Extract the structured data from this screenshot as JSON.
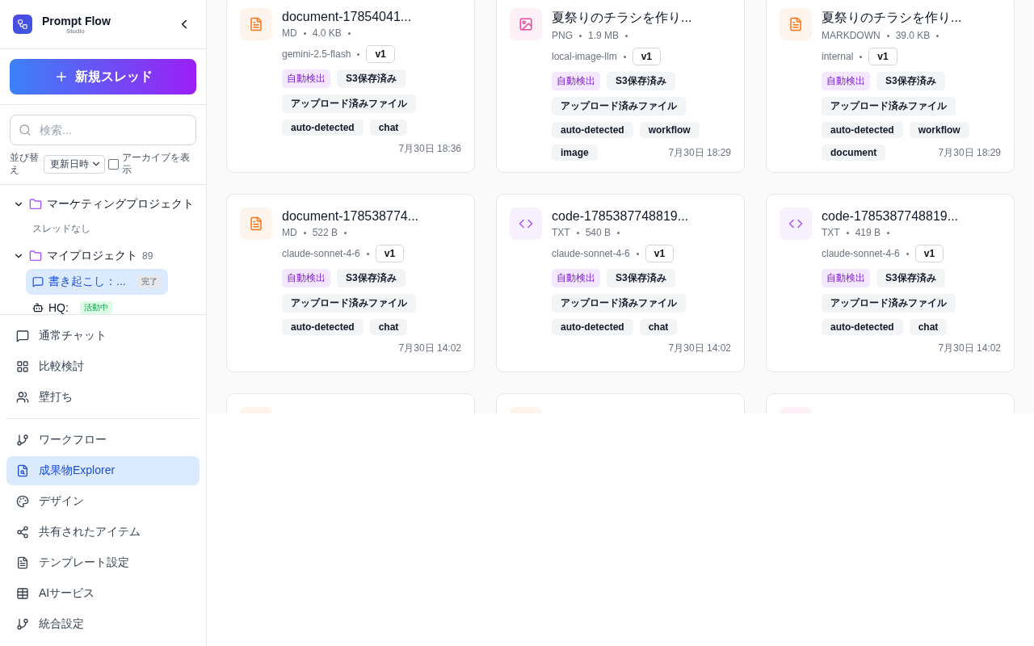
{
  "app": {
    "name": "Prompt Flow",
    "subtitle": "Studio"
  },
  "new_thread_button": "新規スレッド",
  "search": {
    "placeholder": "検索..."
  },
  "sort": {
    "label": "並び替え",
    "value": "更新日時",
    "archive_label": "アーカイブを表示",
    "archive_checked": false
  },
  "tree": [
    {
      "name": "マーケティングプロジェクト",
      "expanded": true,
      "empty_text": "スレッドなし"
    },
    {
      "name": "マイプロジェクト",
      "count": "89",
      "expanded": true,
      "children": [
        {
          "kind": "chat",
          "title": "書き起こし：...",
          "status": "完了",
          "selected": true
        },
        {
          "kind": "workflow",
          "title": "HQ:",
          "status": "活動中",
          "selected": false
        }
      ]
    }
  ],
  "nav_groups": [
    [
      {
        "label": "通常チャット",
        "selected": false
      },
      {
        "label": "比較検討",
        "selected": false
      },
      {
        "label": "壁打ち",
        "selected": false
      }
    ],
    [
      {
        "label": "ワークフロー",
        "selected": false
      },
      {
        "label": "成果物Explorer",
        "selected": true
      },
      {
        "label": "デザイン",
        "selected": false
      },
      {
        "label": "共有されたアイテム",
        "selected": false
      },
      {
        "label": "テンプレート設定",
        "selected": false
      },
      {
        "label": "AIサービス",
        "selected": false
      },
      {
        "label": "統合設定",
        "selected": false
      }
    ]
  ],
  "cards": [
    {
      "kind": "document",
      "title": "document-17854041...",
      "type": "MD",
      "size": "4.0 KB",
      "model": "gemini-2.5-flash",
      "version": "v1",
      "tags": [
        {
          "label": "自動検出",
          "kind": "auto"
        },
        {
          "label": "S3保存済み",
          "kind": "plain"
        },
        {
          "label": "アップロード済みファイル",
          "kind": "plain"
        },
        {
          "label": "auto-detected",
          "kind": "plain"
        },
        {
          "label": "chat",
          "kind": "plain"
        }
      ],
      "date": "7月30日 18:36"
    },
    {
      "kind": "image",
      "title": "夏祭りのチラシを作り...",
      "type": "PNG",
      "size": "1.9 MB",
      "model": "local-image-llm",
      "version": "v1",
      "tags": [
        {
          "label": "自動検出",
          "kind": "auto"
        },
        {
          "label": "S3保存済み",
          "kind": "plain"
        },
        {
          "label": "アップロード済みファイル",
          "kind": "plain"
        },
        {
          "label": "auto-detected",
          "kind": "plain"
        },
        {
          "label": "workflow",
          "kind": "plain"
        },
        {
          "label": "image",
          "kind": "plain"
        }
      ],
      "date": "7月30日 18:29"
    },
    {
      "kind": "document",
      "title": "夏祭りのチラシを作り...",
      "type": "MARKDOWN",
      "size": "39.0 KB",
      "model": "internal",
      "version": "v1",
      "tags": [
        {
          "label": "自動検出",
          "kind": "auto"
        },
        {
          "label": "S3保存済み",
          "kind": "plain"
        },
        {
          "label": "アップロード済みファイル",
          "kind": "plain"
        },
        {
          "label": "auto-detected",
          "kind": "plain"
        },
        {
          "label": "workflow",
          "kind": "plain"
        },
        {
          "label": "document",
          "kind": "plain"
        }
      ],
      "date": "7月30日 18:29"
    },
    {
      "kind": "document",
      "title": "document-178538774...",
      "type": "MD",
      "size": "522 B",
      "model": "claude-sonnet-4-6",
      "version": "v1",
      "tags": [
        {
          "label": "自動検出",
          "kind": "auto"
        },
        {
          "label": "S3保存済み",
          "kind": "plain"
        },
        {
          "label": "アップロード済みファイル",
          "kind": "plain"
        },
        {
          "label": "auto-detected",
          "kind": "plain"
        },
        {
          "label": "chat",
          "kind": "plain"
        }
      ],
      "date": "7月30日 14:02"
    },
    {
      "kind": "code",
      "title": "code-1785387748819...",
      "type": "TXT",
      "size": "540 B",
      "model": "claude-sonnet-4-6",
      "version": "v1",
      "tags": [
        {
          "label": "自動検出",
          "kind": "auto"
        },
        {
          "label": "S3保存済み",
          "kind": "plain"
        },
        {
          "label": "アップロード済みファイル",
          "kind": "plain"
        },
        {
          "label": "auto-detected",
          "kind": "plain"
        },
        {
          "label": "chat",
          "kind": "plain"
        }
      ],
      "date": "7月30日 14:02"
    },
    {
      "kind": "code",
      "title": "code-1785387748819...",
      "type": "TXT",
      "size": "419 B",
      "model": "claude-sonnet-4-6",
      "version": "v1",
      "tags": [
        {
          "label": "自動検出",
          "kind": "auto"
        },
        {
          "label": "S3保存済み",
          "kind": "plain"
        },
        {
          "label": "アップロード済みファイル",
          "kind": "plain"
        },
        {
          "label": "auto-detected",
          "kind": "plain"
        },
        {
          "label": "chat",
          "kind": "plain"
        }
      ],
      "date": "7月30日 14:02"
    },
    {
      "kind": "document"
    },
    {
      "kind": "document"
    },
    {
      "kind": "image"
    }
  ]
}
